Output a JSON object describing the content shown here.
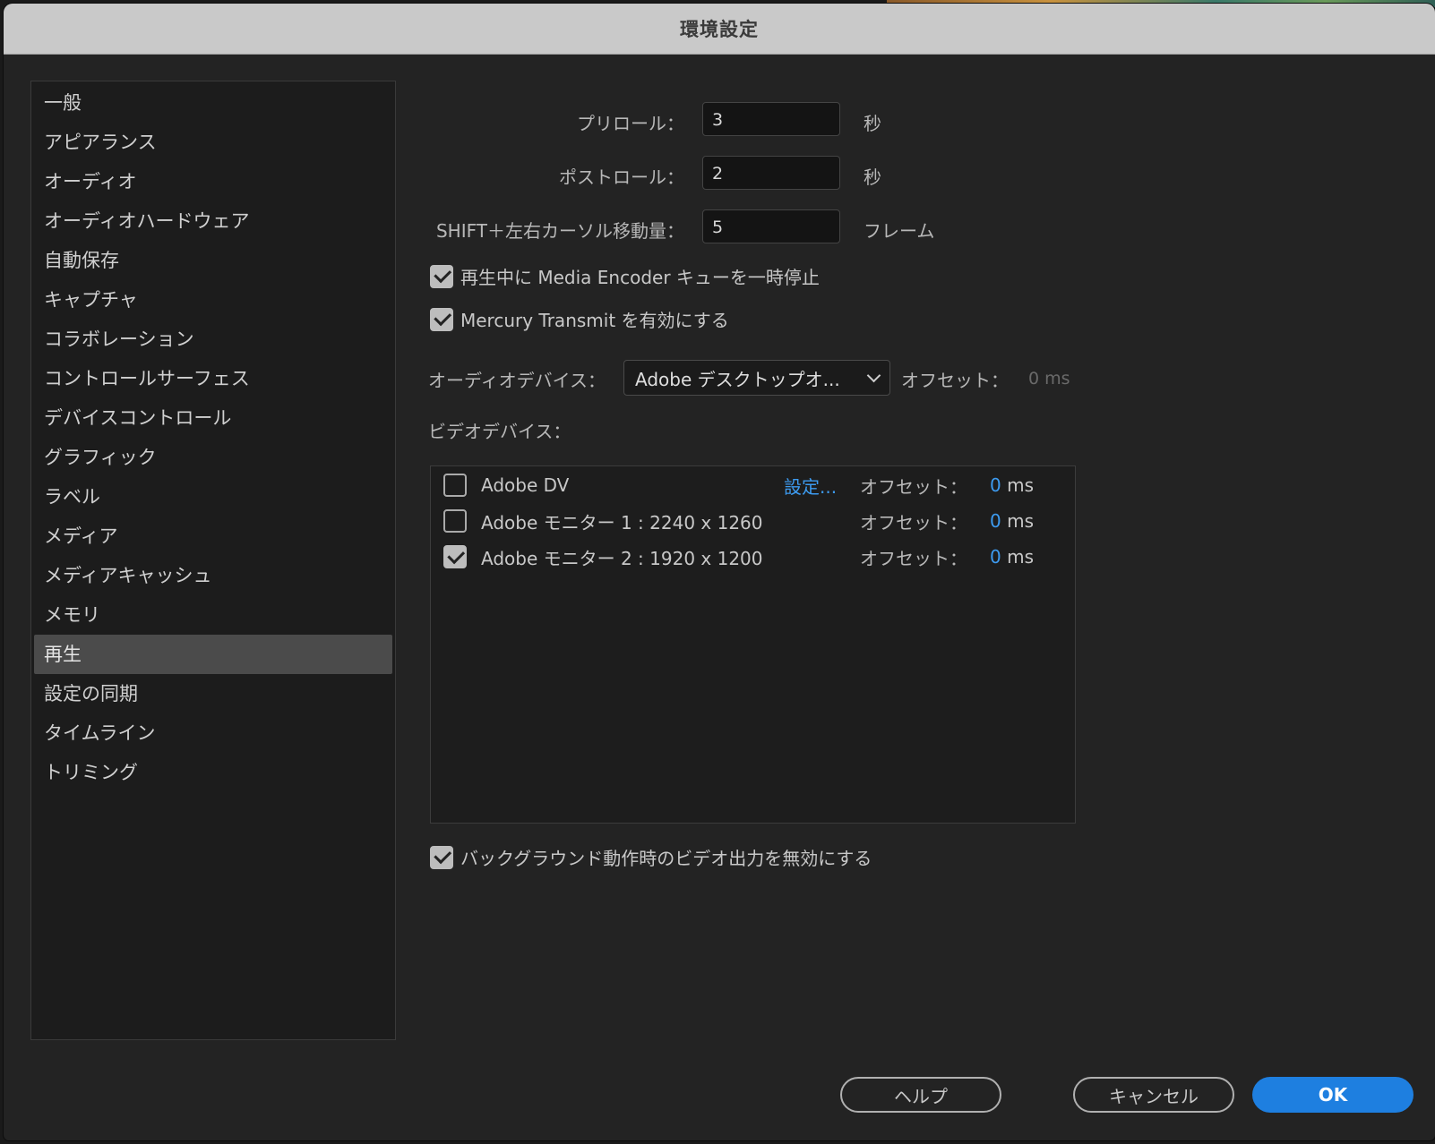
{
  "window": {
    "title": "環境設定"
  },
  "sidebar": {
    "items": [
      {
        "label": "一般"
      },
      {
        "label": "アピアランス"
      },
      {
        "label": "オーディオ"
      },
      {
        "label": "オーディオハードウェア"
      },
      {
        "label": "自動保存"
      },
      {
        "label": "キャプチャ"
      },
      {
        "label": "コラボレーション"
      },
      {
        "label": "コントロールサーフェス"
      },
      {
        "label": "デバイスコントロール"
      },
      {
        "label": "グラフィック"
      },
      {
        "label": "ラベル"
      },
      {
        "label": "メディア"
      },
      {
        "label": "メディアキャッシュ"
      },
      {
        "label": "メモリ"
      },
      {
        "label": "再生"
      },
      {
        "label": "設定の同期"
      },
      {
        "label": "タイムライン"
      },
      {
        "label": "トリミング"
      }
    ],
    "selected": "再生"
  },
  "playback": {
    "preroll": {
      "label": "プリロール：",
      "value": "3",
      "unit": "秒"
    },
    "postroll": {
      "label": "ポストロール：",
      "value": "2",
      "unit": "秒"
    },
    "shift_move": {
      "label": "SHIFT＋左右カーソル移動量：",
      "value": "5",
      "unit": "フレーム"
    },
    "pause_media_encoder": {
      "label": "再生中に Media Encoder キューを一時停止",
      "checked": true
    },
    "mercury_transmit": {
      "label": "Mercury Transmit を有効にする",
      "checked": true
    },
    "audio_device": {
      "label": "オーディオデバイス：",
      "value": "Adobe デスクトップオ...",
      "offset_label": "オフセット：",
      "offset_value": "0 ms"
    },
    "video_device_label": "ビデオデバイス：",
    "video_devices": [
      {
        "name": "Adobe DV",
        "checked": false,
        "settings": "設定...",
        "offset_label": "オフセット：",
        "offset": "0",
        "unit": "ms"
      },
      {
        "name": "Adobe モニター 1 : 2240 x 1260",
        "checked": false,
        "offset_label": "オフセット：",
        "offset": "0",
        "unit": "ms"
      },
      {
        "name": "Adobe モニター 2 : 1920 x 1200",
        "checked": true,
        "offset_label": "オフセット：",
        "offset": "0",
        "unit": "ms"
      }
    ],
    "disable_bg_video": {
      "label": "バックグラウンド動作時のビデオ出力を無効にする",
      "checked": true
    }
  },
  "buttons": {
    "help": "ヘルプ",
    "cancel": "キャンセル",
    "ok": "OK"
  },
  "colors": {
    "accent": "#1e7fe0",
    "link": "#3d9bf0",
    "selected_bg": "#4b4b4b"
  }
}
